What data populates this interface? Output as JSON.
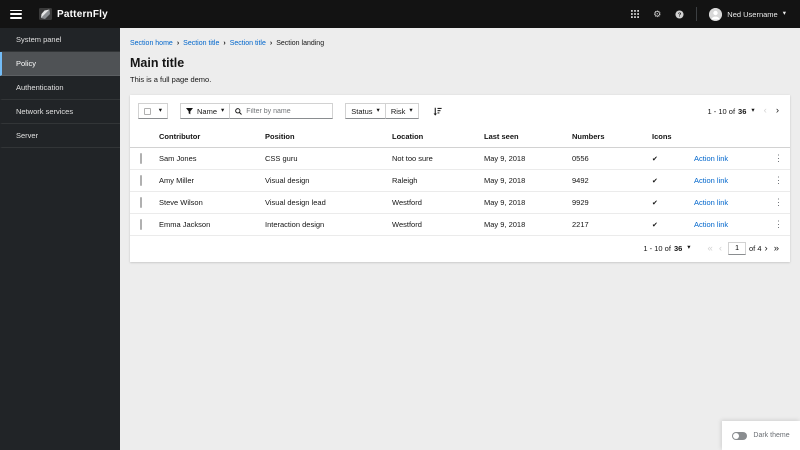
{
  "masthead": {
    "brand": "PatternFly",
    "user": {
      "name": "Ned Username"
    }
  },
  "sidebar": {
    "items": [
      {
        "label": "System panel",
        "selected": false
      },
      {
        "label": "Policy",
        "selected": true
      },
      {
        "label": "Authentication",
        "selected": false
      },
      {
        "label": "Network services",
        "selected": false
      },
      {
        "label": "Server",
        "selected": false
      }
    ]
  },
  "breadcrumb": {
    "items": [
      {
        "label": "Section home"
      },
      {
        "label": "Section title"
      },
      {
        "label": "Section title"
      },
      {
        "label": "Section landing"
      }
    ]
  },
  "page": {
    "title": "Main title",
    "description": "This is a full page demo."
  },
  "toolbar": {
    "name_filter_label": "Name",
    "search_placeholder": "Filter by name",
    "status_label": "Status",
    "risk_label": "Risk"
  },
  "pagination": {
    "range_label": "1 - 10 of",
    "total": "36",
    "current_page": "1",
    "of_pages_label": "of 4"
  },
  "table": {
    "columns": [
      "Contributor",
      "Position",
      "Location",
      "Last seen",
      "Numbers",
      "Icons"
    ],
    "action_label": "Action link",
    "rows": [
      {
        "contributor": "Sam Jones",
        "position": "CSS guru",
        "location": "Not too sure",
        "last_seen": "May 9, 2018",
        "numbers": "0556"
      },
      {
        "contributor": "Amy Miller",
        "position": "Visual design",
        "location": "Raleigh",
        "last_seen": "May 9, 2018",
        "numbers": "9492"
      },
      {
        "contributor": "Steve Wilson",
        "position": "Visual design lead",
        "location": "Westford",
        "last_seen": "May 9, 2018",
        "numbers": "9929"
      },
      {
        "contributor": "Emma Jackson",
        "position": "Interaction design",
        "location": "Westford",
        "last_seen": "May 9, 2018",
        "numbers": "2217"
      }
    ]
  },
  "theme_toggle": {
    "label": "Dark theme"
  },
  "icons": {
    "caret_down": "▾",
    "breadcrumb_separator": "›",
    "gear": "⚙",
    "kebab": "⋮",
    "check": "✔",
    "chevron_left": "‹",
    "chevron_right": "›",
    "chevron_double_left": "«",
    "chevron_double_right": "»"
  },
  "colors": {
    "link": "#0066cc",
    "accent_blue": "#73bcf7",
    "masthead_bg": "#131313",
    "sidebar_bg": "#212427",
    "selected_nav_bg": "#4f5255",
    "page_bg": "#ededed"
  }
}
